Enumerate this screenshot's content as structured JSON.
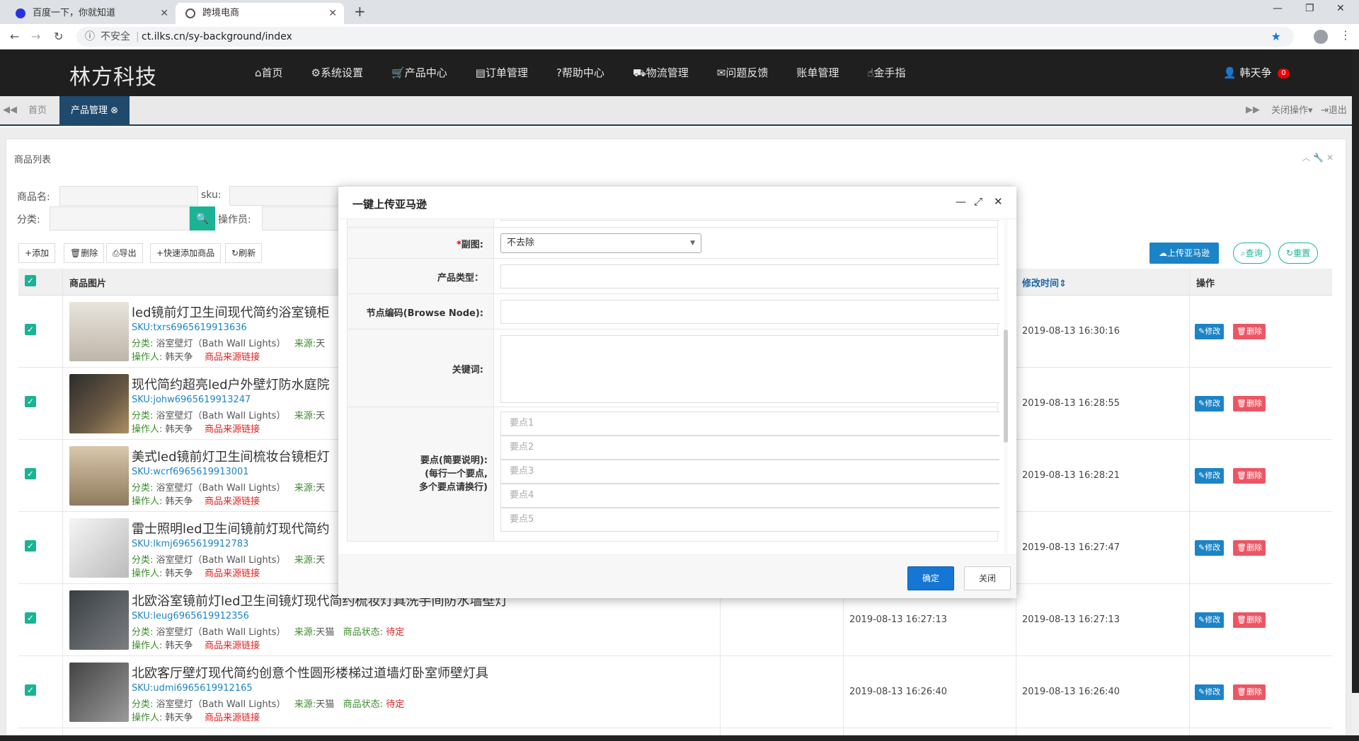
{
  "browser": {
    "tabs": [
      {
        "label": "百度一下，你就知道"
      },
      {
        "label": "跨境电商"
      }
    ],
    "insecure_label": "不安全",
    "url": "ct.ilks.cn/sy-background/index"
  },
  "header": {
    "logo": "林方科技",
    "nav": [
      "首页",
      "系统设置",
      "产品中心",
      "订单管理",
      "帮助中心",
      "物流管理",
      "问题反馈",
      "账单管理",
      "金手指"
    ],
    "nav_icons": [
      "home-icon",
      "gear-icon",
      "cart-icon",
      "file-icon",
      "question-icon",
      "truck-icon",
      "comment-icon",
      "",
      "hand-icon"
    ],
    "user": "韩天争",
    "badge": "0"
  },
  "page_tabs": {
    "home": "首页",
    "active": "产品管理",
    "close_ops": "关闭操作",
    "logout": "退出"
  },
  "panel": {
    "title": "商品列表",
    "filters": {
      "name_label": "商品名:",
      "sku_label": "sku:",
      "category_label": "分类:",
      "operator_label": "操作员:"
    },
    "toolbar": [
      "添加",
      "删除",
      "导出",
      "快速添加商品",
      "刷新"
    ],
    "upload_amazon": "上传亚马逊",
    "query": "查询",
    "reset": "重置"
  },
  "table": {
    "headers": {
      "image": "商品图片",
      "modified": "修改时间",
      "ops": "操作"
    },
    "sku_prefix": "SKU:",
    "cat_prefix": "分类:",
    "source_prefix": "来源:",
    "status_prefix": "商品状态:",
    "operator_prefix": "操作人:",
    "source_link": "商品来源链接",
    "edit": "修改",
    "delete": "删除",
    "rows": [
      {
        "title": "led镜前灯卫生间现代简约浴室镜柜",
        "sku": "txrs6965619913636",
        "category": "浴室壁灯（Bath Wall Lights）",
        "source": "天",
        "status": "",
        "operator": "韩天争",
        "created": "",
        "modified": "2019-08-13 16:30:16"
      },
      {
        "title": "现代简约超亮led户外壁灯防水庭院",
        "sku": "johw6965619913247",
        "category": "浴室壁灯（Bath Wall Lights）",
        "source": "天",
        "status": "",
        "operator": "韩天争",
        "created": "",
        "modified": "2019-08-13 16:28:55"
      },
      {
        "title": "美式led镜前灯卫生间梳妆台镜柜灯",
        "sku": "wcrf6965619913001",
        "category": "浴室壁灯（Bath Wall Lights）",
        "source": "天",
        "status": "",
        "operator": "韩天争",
        "created": "",
        "modified": "2019-08-13 16:28:21"
      },
      {
        "title": "雷士照明led卫生间镜前灯现代简约",
        "sku": "lkmj6965619912783",
        "category": "浴室壁灯（Bath Wall Lights）",
        "source": "天",
        "status": "",
        "operator": "韩天争",
        "created": "",
        "modified": "2019-08-13 16:27:47"
      },
      {
        "title": "北欧浴室镜前灯led卫生间镜灯现代简约梳妆灯具洗手间防水墙壁灯",
        "sku": "leug6965619912356",
        "category": "浴室壁灯（Bath Wall Lights）",
        "source": "天猫",
        "status": "待定",
        "operator": "韩天争",
        "created": "2019-08-13 16:27:13",
        "modified": "2019-08-13 16:27:13"
      },
      {
        "title": "北欧客厅壁灯现代简约创意个性圆形楼梯过道墙灯卧室师壁灯具",
        "sku": "udmi6965619912165",
        "category": "浴室壁灯（Bath Wall Lights）",
        "source": "天猫",
        "status": "待定",
        "operator": "韩天争",
        "created": "2019-08-13 16:26:40",
        "modified": "2019-08-13 16:26:40"
      }
    ]
  },
  "dialog": {
    "title": "一键上传亚马逊",
    "fields": {
      "sub_image_label": "副图:",
      "sub_image_value": "不去除",
      "product_type_label": "产品类型：",
      "browse_node_label": "节点编码(Browse Node):",
      "keywords_label": "关键词:",
      "bullets_label_1": "要点(简要说明):",
      "bullets_label_2": "(每行一个要点,",
      "bullets_label_3": "多个要点请换行)",
      "bullets": [
        "要点1",
        "要点2",
        "要点3",
        "要点4",
        "要点5"
      ]
    },
    "ok": "确定",
    "close": "关闭"
  },
  "colors": {
    "accent_green": "#1ab394",
    "accent_blue": "#1c84c6",
    "danger": "#ed5565",
    "header_bg": "#1f1f1f"
  }
}
